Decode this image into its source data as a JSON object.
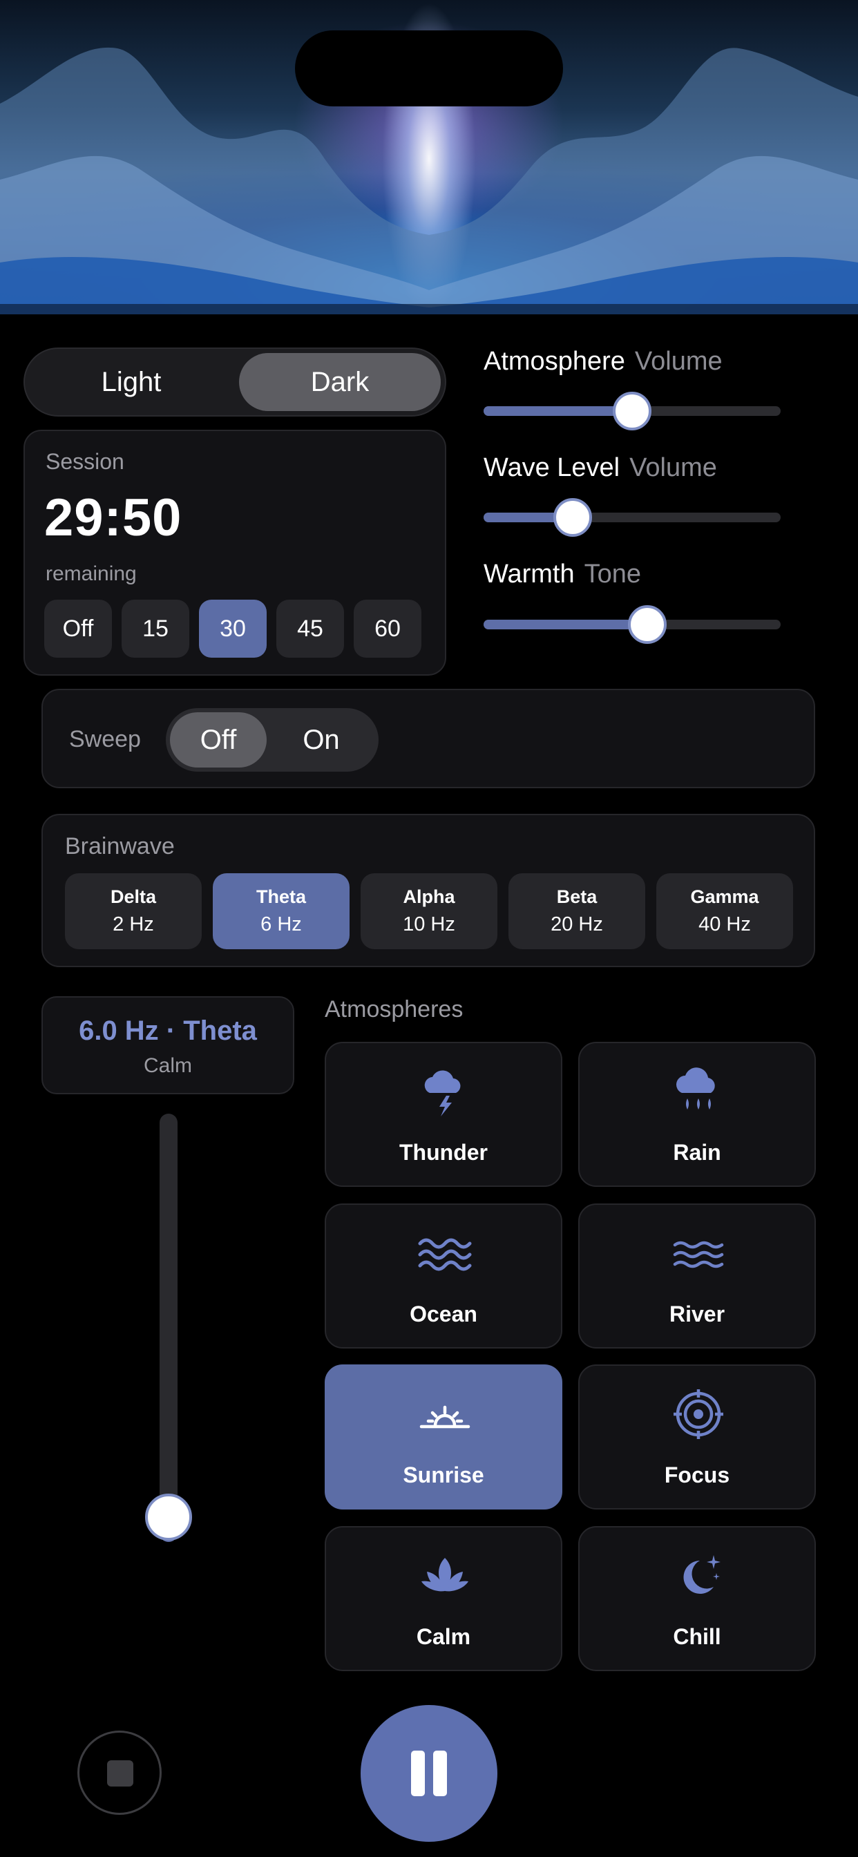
{
  "theme": {
    "light_label": "Light",
    "dark_label": "Dark",
    "selected": "Dark"
  },
  "session": {
    "label": "Session",
    "time": "29:50",
    "remaining_label": "remaining",
    "options": [
      "Off",
      "15",
      "30",
      "45",
      "60"
    ],
    "selected": "30"
  },
  "sliders": [
    {
      "title": "Atmosphere",
      "subtitle": "Volume",
      "value": 0.5
    },
    {
      "title": "Wave Level",
      "subtitle": "Volume",
      "value": 0.3
    },
    {
      "title": "Warmth",
      "subtitle": "Tone",
      "value": 0.55
    }
  ],
  "sweep": {
    "label": "Sweep",
    "off_label": "Off",
    "on_label": "On",
    "selected": "Off"
  },
  "brainwave": {
    "label": "Brainwave",
    "bands": [
      {
        "name": "Delta",
        "hz": "2 Hz"
      },
      {
        "name": "Theta",
        "hz": "6 Hz"
      },
      {
        "name": "Alpha",
        "hz": "10 Hz"
      },
      {
        "name": "Beta",
        "hz": "20 Hz"
      },
      {
        "name": "Gamma",
        "hz": "40 Hz"
      }
    ],
    "selected": "Theta"
  },
  "frequency": {
    "value": "6.0 Hz · Theta",
    "mood": "Calm",
    "level": 0.1
  },
  "atmospheres": {
    "title": "Atmospheres",
    "items": [
      {
        "label": "Thunder",
        "icon": "thunder-icon"
      },
      {
        "label": "Rain",
        "icon": "rain-icon"
      },
      {
        "label": "Ocean",
        "icon": "ocean-icon"
      },
      {
        "label": "River",
        "icon": "river-icon"
      },
      {
        "label": "Sunrise",
        "icon": "sunrise-icon"
      },
      {
        "label": "Focus",
        "icon": "focus-icon"
      },
      {
        "label": "Calm",
        "icon": "calm-icon"
      },
      {
        "label": "Chill",
        "icon": "chill-icon"
      }
    ],
    "selected": "Sunrise"
  },
  "colors": {
    "accent": "#5c6da6",
    "accent_text": "#7e8fd0",
    "background": "#000000",
    "card": "#121215"
  },
  "controls": {
    "stop_icon": "stop-icon",
    "pause_icon": "pause-icon"
  }
}
